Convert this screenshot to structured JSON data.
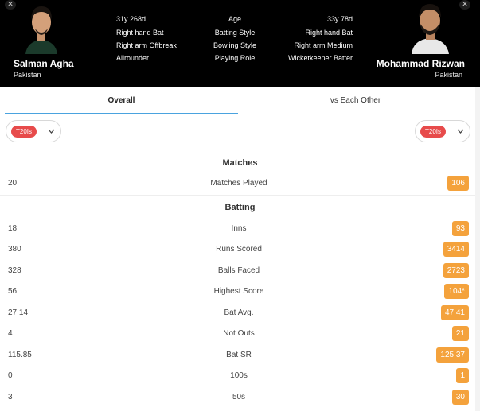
{
  "header": {
    "close_left": "✕",
    "close_right": "✕",
    "left_player": {
      "name": "Salman Agha",
      "country": "Pakistan"
    },
    "right_player": {
      "name": "Mohammad Rizwan",
      "country": "Pakistan"
    },
    "rows": [
      {
        "left": "31y 268d",
        "label": "Age",
        "right": "33y 78d"
      },
      {
        "left": "Right hand Bat",
        "label": "Batting Style",
        "right": "Right hand Bat"
      },
      {
        "left": "Right arm Offbreak",
        "label": "Bowling Style",
        "right": "Right arm Medium"
      },
      {
        "left": "Allrounder",
        "label": "Playing Role",
        "right": "Wicketkeeper Batter"
      }
    ]
  },
  "tabs": {
    "overall": "Overall",
    "each_other": "vs Each Other",
    "active": "Overall"
  },
  "format_left": {
    "value": "T20Is",
    "icon": "chevron-down-icon"
  },
  "format_right": {
    "value": "T20Is",
    "icon": "chevron-down-icon"
  },
  "colors": {
    "accent_tab": "#4aa3df",
    "format_pill": "#e74b4b",
    "value_badge": "#f4a23c",
    "header_bg": "#000000"
  },
  "matches": {
    "title": "Matches",
    "rows": [
      {
        "left": "20",
        "label": "Matches Played",
        "right": "106"
      }
    ]
  },
  "batting": {
    "title": "Batting",
    "rows": [
      {
        "left": "18",
        "label": "Inns",
        "right": "93"
      },
      {
        "left": "380",
        "label": "Runs Scored",
        "right": "3414"
      },
      {
        "left": "328",
        "label": "Balls Faced",
        "right": "2723"
      },
      {
        "left": "56",
        "label": "Highest Score",
        "right": "104*"
      },
      {
        "left": "27.14",
        "label": "Bat Avg.",
        "right": "47.41"
      },
      {
        "left": "4",
        "label": "Not Outs",
        "right": "21"
      },
      {
        "left": "115.85",
        "label": "Bat SR",
        "right": "125.37"
      },
      {
        "left": "0",
        "label": "100s",
        "right": "1"
      },
      {
        "left": "3",
        "label": "50s",
        "right": "30"
      }
    ]
  }
}
